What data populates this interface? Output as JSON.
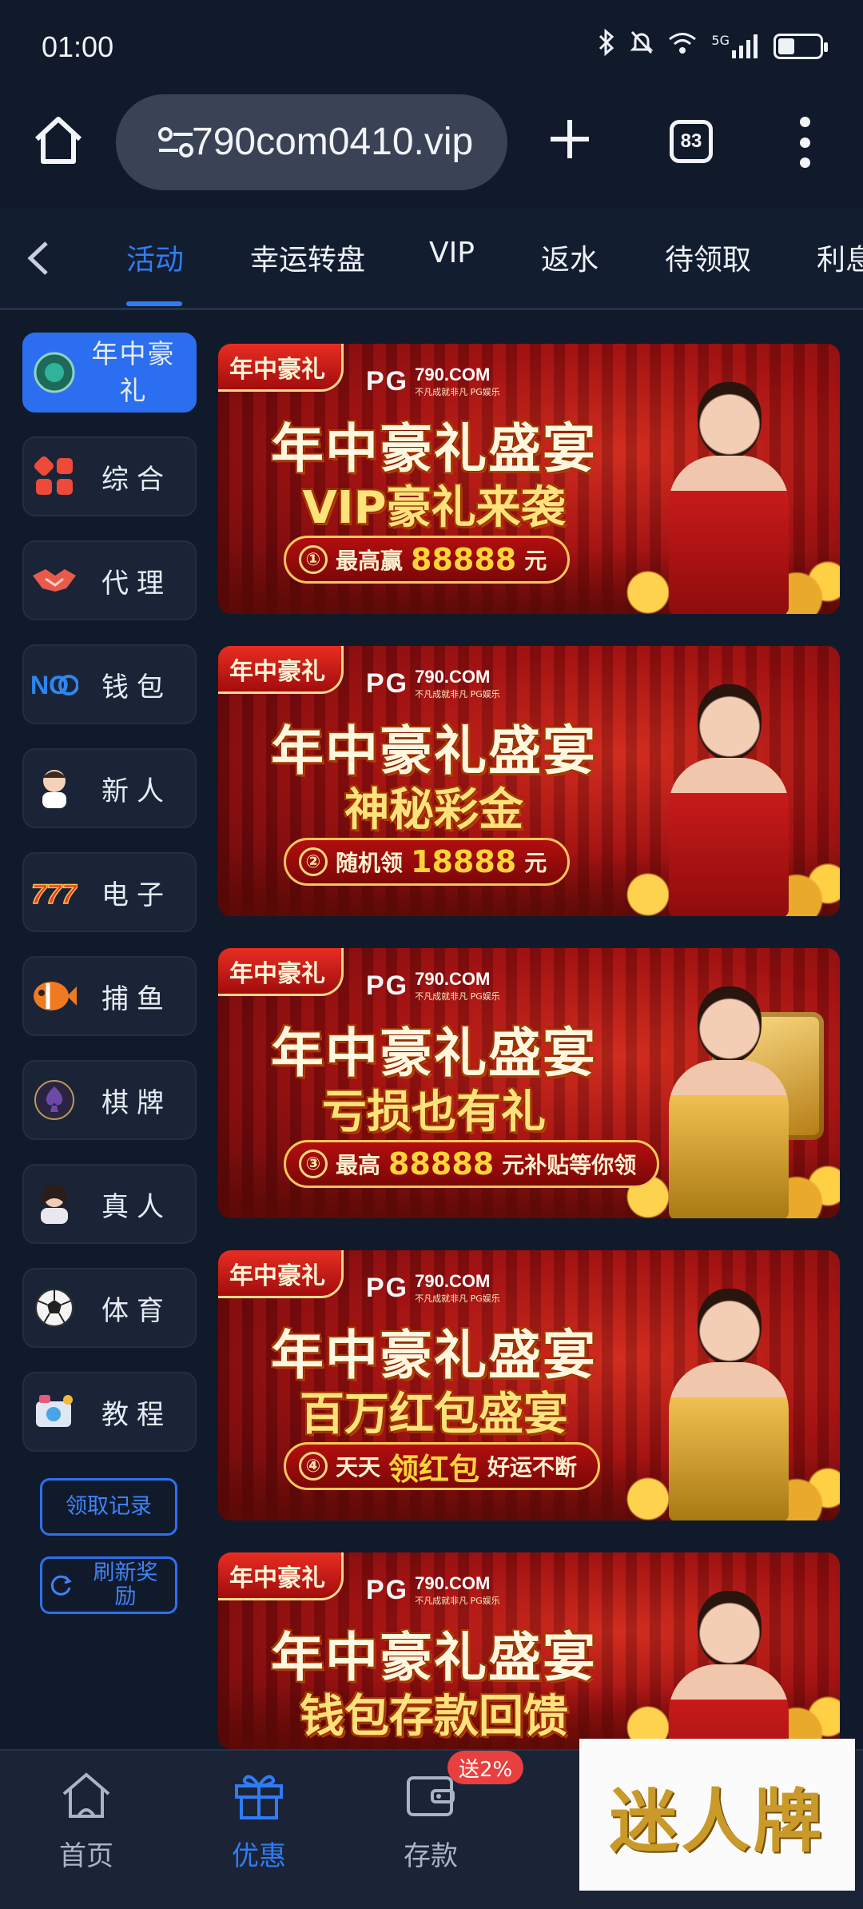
{
  "status_bar": {
    "time": "01:00",
    "network": "5G",
    "battery_percent": 40
  },
  "browser": {
    "url": "790com0410.vip",
    "tab_count": "83"
  },
  "category_tabs": [
    "活动",
    "幸运转盘",
    "VIP",
    "返水",
    "待领取",
    "利息"
  ],
  "active_tab": "活动",
  "sidebar": {
    "items": [
      {
        "label": "年中豪礼",
        "icon": "gift-badge-icon",
        "active": true
      },
      {
        "label": "综合",
        "icon": "grid-icon"
      },
      {
        "label": "代理",
        "icon": "handshake-icon"
      },
      {
        "label": "钱包",
        "icon": "wallet-logo-icon"
      },
      {
        "label": "新人",
        "icon": "newbie-character-icon"
      },
      {
        "label": "电子",
        "icon": "slot-777-icon"
      },
      {
        "label": "捕鱼",
        "icon": "fish-icon"
      },
      {
        "label": "棋牌",
        "icon": "spade-icon"
      },
      {
        "label": "真人",
        "icon": "live-dealer-icon"
      },
      {
        "label": "体育",
        "icon": "soccer-ball-icon"
      },
      {
        "label": "教程",
        "icon": "tutorial-icon"
      }
    ],
    "claim_record_label": "领取记录",
    "refresh_label": "刷新奖励"
  },
  "banners": [
    {
      "tag": "年中豪礼",
      "brand_logo": "PG",
      "site": "790.COM",
      "slogan": "不凡成就非凡 PG娱乐",
      "title": "年中豪礼盛宴",
      "subtitle": "VIP豪礼来袭",
      "step": "①",
      "text_before": "最高赢",
      "amount": "88888",
      "text_after": "元"
    },
    {
      "tag": "年中豪礼",
      "brand_logo": "PG",
      "site": "790.COM",
      "slogan": "不凡成就非凡 PG娱乐",
      "title": "年中豪礼盛宴",
      "subtitle": "神秘彩金",
      "step": "②",
      "text_before": "随机领",
      "amount": "18888",
      "text_after": "元"
    },
    {
      "tag": "年中豪礼",
      "brand_logo": "PG",
      "site": "790.COM",
      "slogan": "不凡成就非凡 PG娱乐",
      "title": "年中豪礼盛宴",
      "subtitle": "亏损也有礼",
      "step": "③",
      "text_before": "最高",
      "amount": "88888",
      "text_after": "元补贴等你领"
    },
    {
      "tag": "年中豪礼",
      "brand_logo": "PG",
      "site": "790.COM",
      "slogan": "不凡成就非凡 PG娱乐",
      "title": "年中豪礼盛宴",
      "subtitle": "百万红包盛宴",
      "step": "④",
      "text_before": "天天",
      "amount": "领红包",
      "text_after": "好运不断"
    },
    {
      "tag": "年中豪礼",
      "brand_logo": "PG",
      "site": "790.COM",
      "slogan": "不凡成就非凡 PG娱乐",
      "title": "年中豪礼盛宴",
      "subtitle": "钱包存款回馈",
      "step": "",
      "text_before": "",
      "amount": "",
      "text_after": ""
    }
  ],
  "bottom_nav": [
    {
      "label": "首页",
      "icon": "home-icon"
    },
    {
      "label": "优惠",
      "icon": "gift-icon",
      "active": true
    },
    {
      "label": "存款",
      "icon": "wallet-icon"
    }
  ],
  "deposit_badge": "送2%",
  "watermark_text": "迷人牌",
  "colors": {
    "accent": "#2f7cf6",
    "background": "#111a2b",
    "card": "#1a2436",
    "badge": "#e83f3f"
  }
}
